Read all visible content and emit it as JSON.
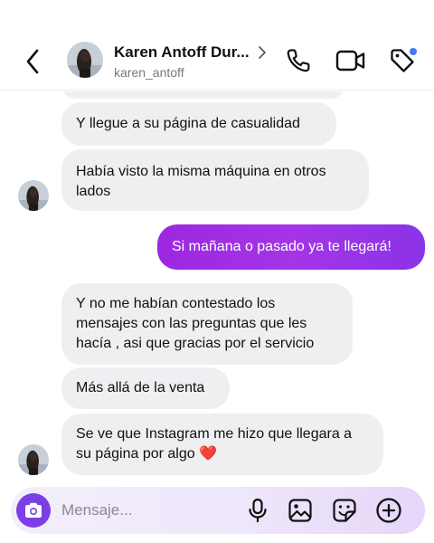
{
  "header": {
    "contact_name": "Karen Antoff Dur...",
    "username": "karen_antoff"
  },
  "messages": [
    {
      "direction": "incoming",
      "text": ""
    },
    {
      "direction": "incoming",
      "text": "Y llegue a su página de casualidad"
    },
    {
      "direction": "incoming",
      "text": "Había visto la misma máquina en otros lados"
    },
    {
      "direction": "outgoing",
      "text": "Si mañana o pasado ya te llegará!"
    },
    {
      "direction": "incoming",
      "text": "Y no me habían contestado los mensajes con las preguntas que les hacía , asi que gracias por el servicio"
    },
    {
      "direction": "incoming",
      "text": "Más allá de la venta"
    },
    {
      "direction": "incoming",
      "text": "Se ve que Instagram me hizo que llegara a su página por algo",
      "emoji": "❤️"
    }
  ],
  "composer": {
    "placeholder": "Mensaje..."
  },
  "icons": {
    "back": "chevron-left-icon",
    "call": "phone-icon",
    "video": "video-camera-icon",
    "tag": "tag-icon",
    "camera": "camera-icon",
    "mic": "microphone-icon",
    "gallery": "image-icon",
    "sticker": "sticker-icon",
    "add": "plus-circle-icon"
  },
  "colors": {
    "outgoing_bubble": "#9d27e0",
    "incoming_bubble": "#efeff2",
    "camera_button": "#7b3fe4",
    "notification_dot": "#3d7cf2",
    "heart": "#d81b32"
  }
}
